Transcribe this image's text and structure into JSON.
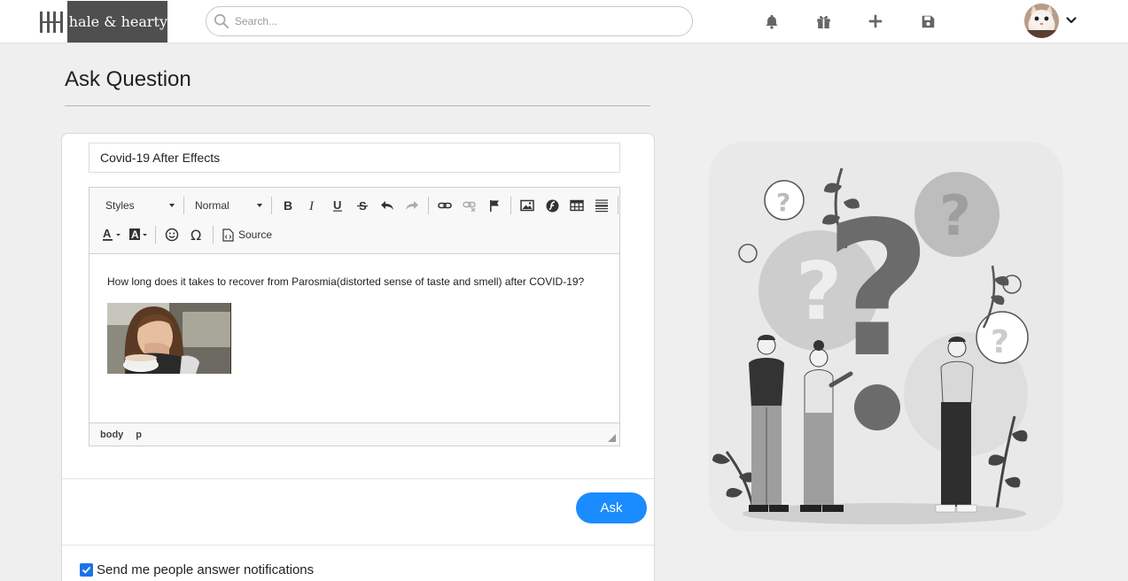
{
  "header": {
    "logo_mark": "H",
    "brand": "hale & hearty",
    "search_placeholder": "Search...",
    "icons": [
      "bell-icon",
      "gift-icon",
      "plus-icon",
      "save-icon"
    ],
    "avatar": "user-avatar"
  },
  "page": {
    "title": "Ask Question"
  },
  "form": {
    "question_title": "Covid-19 After Effects",
    "toolbar": {
      "styles_label": "Styles",
      "format_label": "Normal",
      "source_label": "Source"
    },
    "body_text": "How long does it takes to recover from Parosmia(distorted sense of taste and smell) after COVID-19?",
    "path": [
      "body",
      "p"
    ],
    "ask_label": "Ask",
    "notify_label": "Send me people answer notifications",
    "notify_checked": true
  },
  "colors": {
    "accent": "#1a8cff",
    "logo_bg": "#4f4f4f"
  }
}
